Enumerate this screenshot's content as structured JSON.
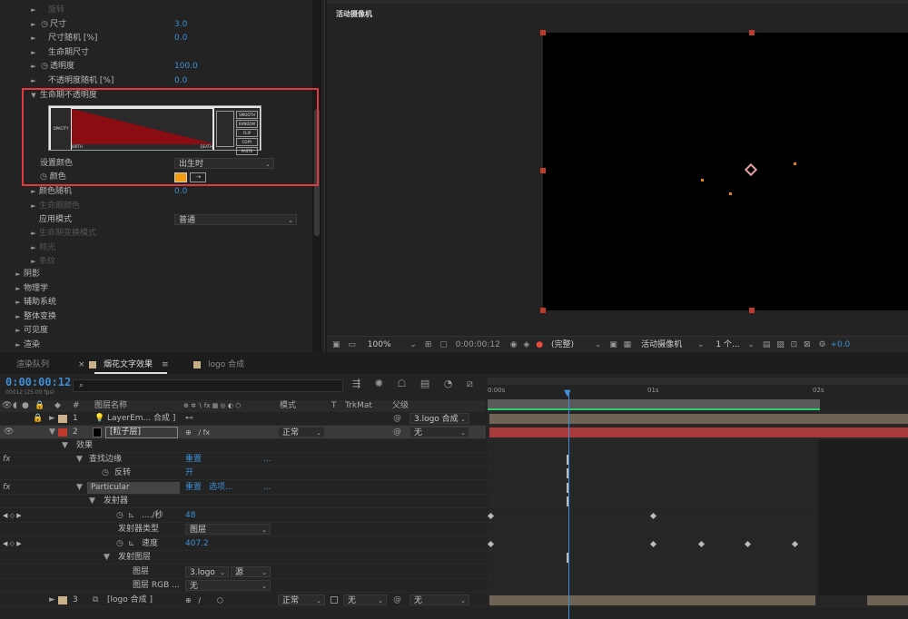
{
  "effect_controls": {
    "items": [
      {
        "label": "旋转",
        "value": "",
        "dim": true,
        "stopwatch": false
      },
      {
        "label": "尺寸",
        "value": "3.0",
        "dim": false,
        "stopwatch": true
      },
      {
        "label": "尺寸随机 [%]",
        "value": "0.0",
        "dim": false,
        "stopwatch": false
      },
      {
        "label": "生命期尺寸",
        "value": "",
        "dim": false,
        "stopwatch": false
      },
      {
        "label": "透明度",
        "value": "100.0",
        "dim": false,
        "stopwatch": true
      },
      {
        "label": "不透明度随机 [%]",
        "value": "0.0",
        "dim": false,
        "stopwatch": false
      }
    ],
    "opacity_over_life": {
      "label": "生命期不透明度",
      "graph_y": "OPACITY",
      "graph_birth": "BIRTH",
      "graph_death": "DEATH",
      "presets": [
        "SMOOTH",
        "RANDOM",
        "FLIP",
        "COPY",
        "PASTE"
      ],
      "set_color_label": "设置颜色",
      "set_color_value": "出生时",
      "color_label": "颜色",
      "color_hex": "#f39c12"
    },
    "items_after": [
      {
        "label": "颜色随机",
        "value": "0.0",
        "dim": false
      },
      {
        "label": "生命期颜色",
        "value": "",
        "dim": true
      }
    ],
    "blend_mode": {
      "label": "应用模式",
      "value": "普通"
    },
    "items_dim": [
      "生命期变换模式",
      "频光",
      "条纹"
    ],
    "groups": [
      "阴影",
      "物理学",
      "辅助系统",
      "整体变换",
      "可见度",
      "渲染"
    ]
  },
  "viewer": {
    "camera_label": "活动摄像机",
    "zoom": "100%",
    "timecode": "0:00:00:12",
    "quality": "(完整)",
    "view": "活动摄像机",
    "views_count": "1 个...",
    "exposure": "+0.0"
  },
  "tabs": [
    "渲染队列",
    "烟花文字效果",
    "logo 合成"
  ],
  "timeline": {
    "timecode": "0:00:00:12",
    "fps": "00012 (25.00 fps)",
    "search_icon": "⌕",
    "col_source": "图层名称",
    "col_mode": "模式",
    "col_t": "T",
    "col_trkmat": "TrkMat",
    "col_parent": "父级",
    "ruler": [
      "0:00s",
      "01s",
      "02s"
    ]
  },
  "layers": [
    {
      "num": "1",
      "name": "LayerEm... 合成 ]",
      "color": "#c8b08a",
      "mode": "",
      "trk": "",
      "parent": "3.logo 合成"
    },
    {
      "num": "2",
      "name": "[粒子层]",
      "color": "#c0392b",
      "mode": "正常",
      "trk": "",
      "parent": "无"
    },
    {
      "num": "3",
      "name": "[logo 合成 ]",
      "color": "#c8b08a",
      "mode": "正常",
      "trk": "无",
      "parent": "无"
    }
  ],
  "props": {
    "effects": "效果",
    "find_edges": "查找边缘",
    "reset": "重置",
    "dots": "...",
    "invert": "反转",
    "invert_val": "开",
    "particular": "Particular",
    "options": "选项...",
    "emitter": "发射器",
    "rate": "..../秒",
    "rate_val": "48",
    "emitter_type": "发射器类型",
    "emitter_type_val": "图层",
    "velocity": "速度",
    "velocity_val": "407.2",
    "emit_layer": "发射图层",
    "layer": "图层",
    "layer_val": "3.logo",
    "layer_src": "源",
    "layer_rgb": "图层 RGB ...",
    "layer_rgb_val": "无"
  }
}
